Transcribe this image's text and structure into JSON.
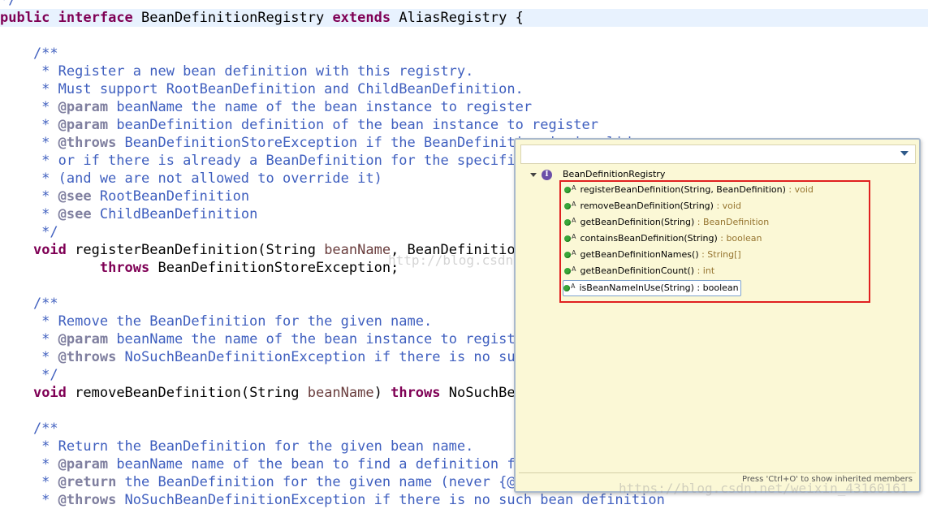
{
  "editor": {
    "lines": [
      {
        "spans": [
          {
            "t": "*/",
            "c": "jd"
          }
        ]
      },
      {
        "current": true,
        "spans": [
          {
            "t": "public",
            "c": "kw"
          },
          {
            "t": " "
          },
          {
            "t": "interface",
            "c": "kw"
          },
          {
            "t": " BeanDefinitionRegistry "
          },
          {
            "t": "extends",
            "c": "kw"
          },
          {
            "t": " AliasRegistry {"
          }
        ]
      },
      {
        "spans": []
      },
      {
        "spans": [
          {
            "t": "    /**",
            "c": "jd"
          }
        ]
      },
      {
        "spans": [
          {
            "t": "     * Register a new bean definition with this registry.",
            "c": "jd"
          }
        ]
      },
      {
        "spans": [
          {
            "t": "     * Must support RootBeanDefinition and ChildBeanDefinition.",
            "c": "jd"
          }
        ]
      },
      {
        "spans": [
          {
            "t": "     * ",
            "c": "jd"
          },
          {
            "t": "@param",
            "c": "tag"
          },
          {
            "t": " beanName the name of the bean instance to register",
            "c": "jd"
          }
        ]
      },
      {
        "spans": [
          {
            "t": "     * ",
            "c": "jd"
          },
          {
            "t": "@param",
            "c": "tag"
          },
          {
            "t": " beanDefinition definition of the bean instance to register",
            "c": "jd"
          }
        ]
      },
      {
        "spans": [
          {
            "t": "     * ",
            "c": "jd"
          },
          {
            "t": "@throws",
            "c": "tag"
          },
          {
            "t": " BeanDefinitionStoreException if the BeanDefinition is invalid",
            "c": "jd"
          }
        ]
      },
      {
        "spans": [
          {
            "t": "     * or if there is already a BeanDefinition for the specified",
            "c": "jd"
          }
        ]
      },
      {
        "spans": [
          {
            "t": "     * (and we are not allowed to override it)",
            "c": "jd"
          }
        ]
      },
      {
        "spans": [
          {
            "t": "     * ",
            "c": "jd"
          },
          {
            "t": "@see",
            "c": "tag"
          },
          {
            "t": " RootBeanDefinition",
            "c": "jd"
          }
        ]
      },
      {
        "spans": [
          {
            "t": "     * ",
            "c": "jd"
          },
          {
            "t": "@see",
            "c": "tag"
          },
          {
            "t": " ChildBeanDefinition",
            "c": "jd"
          }
        ]
      },
      {
        "spans": [
          {
            "t": "     */",
            "c": "jd"
          }
        ]
      },
      {
        "spans": [
          {
            "t": "    "
          },
          {
            "t": "void",
            "c": "kw"
          },
          {
            "t": " registerBeanDefinition(String "
          },
          {
            "t": "beanName",
            "c": "param"
          },
          {
            "t": ", BeanDefinition "
          }
        ]
      },
      {
        "spans": [
          {
            "t": "            "
          },
          {
            "t": "throws",
            "c": "kw"
          },
          {
            "t": " BeanDefinitionStoreException;"
          }
        ]
      },
      {
        "spans": []
      },
      {
        "spans": [
          {
            "t": "    /**",
            "c": "jd"
          }
        ]
      },
      {
        "spans": [
          {
            "t": "     * Remove the BeanDefinition for the given name.",
            "c": "jd"
          }
        ]
      },
      {
        "spans": [
          {
            "t": "     * ",
            "c": "jd"
          },
          {
            "t": "@param",
            "c": "tag"
          },
          {
            "t": " beanName the name of the bean instance to register",
            "c": "jd"
          }
        ]
      },
      {
        "spans": [
          {
            "t": "     * ",
            "c": "jd"
          },
          {
            "t": "@throws",
            "c": "tag"
          },
          {
            "t": " NoSuchBeanDefinitionException if there is no such",
            "c": "jd"
          }
        ]
      },
      {
        "spans": [
          {
            "t": "     */",
            "c": "jd"
          }
        ]
      },
      {
        "spans": [
          {
            "t": "    "
          },
          {
            "t": "void",
            "c": "kw"
          },
          {
            "t": " removeBeanDefinition(String "
          },
          {
            "t": "beanName",
            "c": "param"
          },
          {
            "t": ") "
          },
          {
            "t": "throws",
            "c": "kw"
          },
          {
            "t": " NoSuchBean"
          }
        ]
      },
      {
        "spans": []
      },
      {
        "spans": [
          {
            "t": "    /**",
            "c": "jd"
          }
        ]
      },
      {
        "spans": [
          {
            "t": "     * Return the BeanDefinition for the given bean name.",
            "c": "jd"
          }
        ]
      },
      {
        "spans": [
          {
            "t": "     * ",
            "c": "jd"
          },
          {
            "t": "@param",
            "c": "tag"
          },
          {
            "t": " beanName name of the bean to find a definition for",
            "c": "jd"
          }
        ]
      },
      {
        "spans": [
          {
            "t": "     * ",
            "c": "jd"
          },
          {
            "t": "@return",
            "c": "tag"
          },
          {
            "t": " the BeanDefinition for the given name (never {@code null})",
            "c": "jd"
          }
        ]
      },
      {
        "spans": [
          {
            "t": "     * ",
            "c": "jd"
          },
          {
            "t": "@throws",
            "c": "tag"
          },
          {
            "t": " NoSuchBeanDefinitionException if there is no such bean definition",
            "c": "jd"
          }
        ]
      }
    ],
    "watermark_1": "http://blog.csdn.net/",
    "watermark_2": "https://blog.csdn.net/weixin_43160161"
  },
  "outline": {
    "root_label": "BeanDefinitionRegistry",
    "root_icon": "interface-icon",
    "abstract_marker": "A",
    "members": [
      {
        "name": "registerBeanDefinition(String, BeanDefinition)",
        "type": " : void"
      },
      {
        "name": "removeBeanDefinition(String)",
        "type": " : void"
      },
      {
        "name": "getBeanDefinition(String)",
        "type": " : BeanDefinition"
      },
      {
        "name": "containsBeanDefinition(String)",
        "type": " : boolean"
      },
      {
        "name": "getBeanDefinitionNames()",
        "type": " : String[]"
      },
      {
        "name": "getBeanDefinitionCount()",
        "type": " : int"
      },
      {
        "name": "isBeanNameInUse(String) : boolean",
        "type": "",
        "selected": true
      }
    ],
    "footer_hint": "Press 'Ctrl+O' to show inherited members",
    "highlight_color": "#e02020",
    "method_icon": "public-method-icon"
  }
}
